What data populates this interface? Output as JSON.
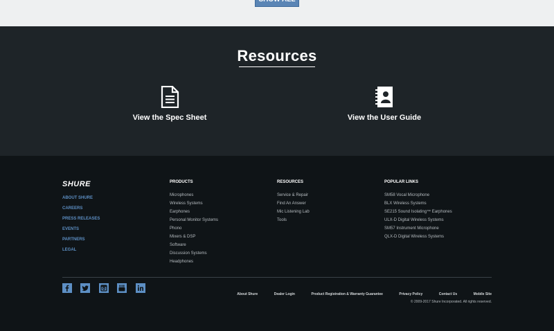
{
  "top": {
    "show_all_label": "SHOW ALL"
  },
  "resources": {
    "title": "Resources",
    "items": [
      {
        "label": "View the Spec Sheet",
        "icon": "document-icon"
      },
      {
        "label": "View the User Guide",
        "icon": "user-guide-icon"
      }
    ]
  },
  "footer": {
    "logo": "SHURE",
    "about_links": [
      "ABOUT SHURE",
      "CAREERS",
      "PRESS RELEASES",
      "EVENTS",
      "PARTNERS",
      "LEGAL"
    ],
    "products": {
      "heading": "PRODUCTS",
      "links": [
        "Microphones",
        "Wireless Systems",
        "Earphones",
        "Personal Monitor Systems",
        "Phono",
        "Mixers & DSP",
        "Software",
        "Discussion Systems",
        "Headphones"
      ]
    },
    "resources": {
      "heading": "RESOURCES",
      "links": [
        "Service & Repair",
        "Find An Answer",
        "Mic Listening Lab",
        "Tools"
      ]
    },
    "popular": {
      "heading": "POPULAR LINKS",
      "links": [
        "SM58 Vocal Microphone",
        "BLX Wireless Systems",
        "SE215 Sound Isolating™ Earphones",
        "ULX-D Digital Wireless Systems",
        "SM57 Instrument Microphone",
        "QLX-D Digital Wireless Systems"
      ]
    },
    "social": [
      "facebook-icon",
      "twitter-icon",
      "instagram-icon",
      "youtube-icon",
      "linkedin-icon"
    ],
    "bottom_links": [
      "About Shure",
      "Dealer Login",
      "Product Registration & Warranty Guarantee",
      "Privacy Policy",
      "Contact Us",
      "Mobile Site"
    ],
    "copyright": "© 2009-2017 Shure Incorporated. All rights reserved."
  },
  "colors": {
    "accent_link": "#5d8fc4",
    "resources_bg": "#1e2428",
    "footer_bg": "#0f1417",
    "show_all_button": "#5a85b5"
  }
}
